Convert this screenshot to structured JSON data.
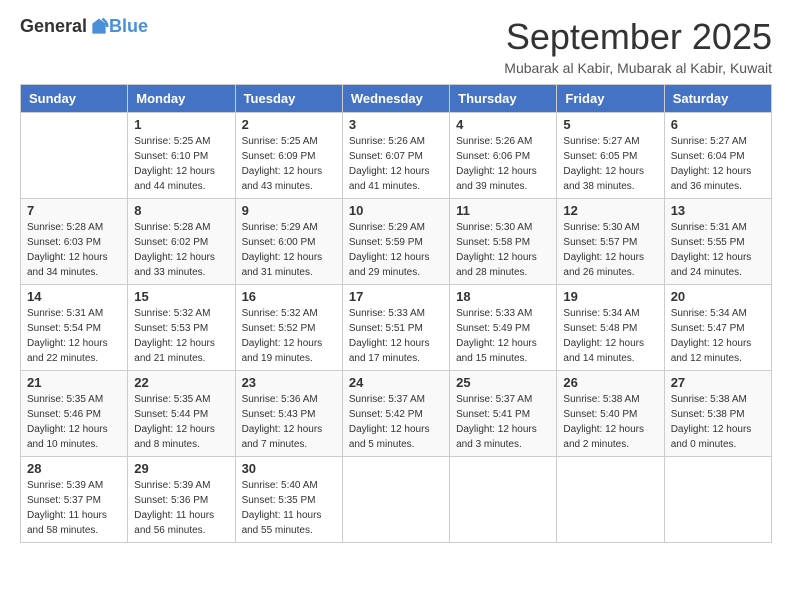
{
  "logo": {
    "general": "General",
    "blue": "Blue"
  },
  "header": {
    "month": "September 2025",
    "location": "Mubarak al Kabir, Mubarak al Kabir, Kuwait"
  },
  "weekdays": [
    "Sunday",
    "Monday",
    "Tuesday",
    "Wednesday",
    "Thursday",
    "Friday",
    "Saturday"
  ],
  "weeks": [
    [
      {
        "day": "",
        "sunrise": "",
        "sunset": "",
        "daylight": ""
      },
      {
        "day": "1",
        "sunrise": "Sunrise: 5:25 AM",
        "sunset": "Sunset: 6:10 PM",
        "daylight": "Daylight: 12 hours and 44 minutes."
      },
      {
        "day": "2",
        "sunrise": "Sunrise: 5:25 AM",
        "sunset": "Sunset: 6:09 PM",
        "daylight": "Daylight: 12 hours and 43 minutes."
      },
      {
        "day": "3",
        "sunrise": "Sunrise: 5:26 AM",
        "sunset": "Sunset: 6:07 PM",
        "daylight": "Daylight: 12 hours and 41 minutes."
      },
      {
        "day": "4",
        "sunrise": "Sunrise: 5:26 AM",
        "sunset": "Sunset: 6:06 PM",
        "daylight": "Daylight: 12 hours and 39 minutes."
      },
      {
        "day": "5",
        "sunrise": "Sunrise: 5:27 AM",
        "sunset": "Sunset: 6:05 PM",
        "daylight": "Daylight: 12 hours and 38 minutes."
      },
      {
        "day": "6",
        "sunrise": "Sunrise: 5:27 AM",
        "sunset": "Sunset: 6:04 PM",
        "daylight": "Daylight: 12 hours and 36 minutes."
      }
    ],
    [
      {
        "day": "7",
        "sunrise": "Sunrise: 5:28 AM",
        "sunset": "Sunset: 6:03 PM",
        "daylight": "Daylight: 12 hours and 34 minutes."
      },
      {
        "day": "8",
        "sunrise": "Sunrise: 5:28 AM",
        "sunset": "Sunset: 6:02 PM",
        "daylight": "Daylight: 12 hours and 33 minutes."
      },
      {
        "day": "9",
        "sunrise": "Sunrise: 5:29 AM",
        "sunset": "Sunset: 6:00 PM",
        "daylight": "Daylight: 12 hours and 31 minutes."
      },
      {
        "day": "10",
        "sunrise": "Sunrise: 5:29 AM",
        "sunset": "Sunset: 5:59 PM",
        "daylight": "Daylight: 12 hours and 29 minutes."
      },
      {
        "day": "11",
        "sunrise": "Sunrise: 5:30 AM",
        "sunset": "Sunset: 5:58 PM",
        "daylight": "Daylight: 12 hours and 28 minutes."
      },
      {
        "day": "12",
        "sunrise": "Sunrise: 5:30 AM",
        "sunset": "Sunset: 5:57 PM",
        "daylight": "Daylight: 12 hours and 26 minutes."
      },
      {
        "day": "13",
        "sunrise": "Sunrise: 5:31 AM",
        "sunset": "Sunset: 5:55 PM",
        "daylight": "Daylight: 12 hours and 24 minutes."
      }
    ],
    [
      {
        "day": "14",
        "sunrise": "Sunrise: 5:31 AM",
        "sunset": "Sunset: 5:54 PM",
        "daylight": "Daylight: 12 hours and 22 minutes."
      },
      {
        "day": "15",
        "sunrise": "Sunrise: 5:32 AM",
        "sunset": "Sunset: 5:53 PM",
        "daylight": "Daylight: 12 hours and 21 minutes."
      },
      {
        "day": "16",
        "sunrise": "Sunrise: 5:32 AM",
        "sunset": "Sunset: 5:52 PM",
        "daylight": "Daylight: 12 hours and 19 minutes."
      },
      {
        "day": "17",
        "sunrise": "Sunrise: 5:33 AM",
        "sunset": "Sunset: 5:51 PM",
        "daylight": "Daylight: 12 hours and 17 minutes."
      },
      {
        "day": "18",
        "sunrise": "Sunrise: 5:33 AM",
        "sunset": "Sunset: 5:49 PM",
        "daylight": "Daylight: 12 hours and 15 minutes."
      },
      {
        "day": "19",
        "sunrise": "Sunrise: 5:34 AM",
        "sunset": "Sunset: 5:48 PM",
        "daylight": "Daylight: 12 hours and 14 minutes."
      },
      {
        "day": "20",
        "sunrise": "Sunrise: 5:34 AM",
        "sunset": "Sunset: 5:47 PM",
        "daylight": "Daylight: 12 hours and 12 minutes."
      }
    ],
    [
      {
        "day": "21",
        "sunrise": "Sunrise: 5:35 AM",
        "sunset": "Sunset: 5:46 PM",
        "daylight": "Daylight: 12 hours and 10 minutes."
      },
      {
        "day": "22",
        "sunrise": "Sunrise: 5:35 AM",
        "sunset": "Sunset: 5:44 PM",
        "daylight": "Daylight: 12 hours and 8 minutes."
      },
      {
        "day": "23",
        "sunrise": "Sunrise: 5:36 AM",
        "sunset": "Sunset: 5:43 PM",
        "daylight": "Daylight: 12 hours and 7 minutes."
      },
      {
        "day": "24",
        "sunrise": "Sunrise: 5:37 AM",
        "sunset": "Sunset: 5:42 PM",
        "daylight": "Daylight: 12 hours and 5 minutes."
      },
      {
        "day": "25",
        "sunrise": "Sunrise: 5:37 AM",
        "sunset": "Sunset: 5:41 PM",
        "daylight": "Daylight: 12 hours and 3 minutes."
      },
      {
        "day": "26",
        "sunrise": "Sunrise: 5:38 AM",
        "sunset": "Sunset: 5:40 PM",
        "daylight": "Daylight: 12 hours and 2 minutes."
      },
      {
        "day": "27",
        "sunrise": "Sunrise: 5:38 AM",
        "sunset": "Sunset: 5:38 PM",
        "daylight": "Daylight: 12 hours and 0 minutes."
      }
    ],
    [
      {
        "day": "28",
        "sunrise": "Sunrise: 5:39 AM",
        "sunset": "Sunset: 5:37 PM",
        "daylight": "Daylight: 11 hours and 58 minutes."
      },
      {
        "day": "29",
        "sunrise": "Sunrise: 5:39 AM",
        "sunset": "Sunset: 5:36 PM",
        "daylight": "Daylight: 11 hours and 56 minutes."
      },
      {
        "day": "30",
        "sunrise": "Sunrise: 5:40 AM",
        "sunset": "Sunset: 5:35 PM",
        "daylight": "Daylight: 11 hours and 55 minutes."
      },
      {
        "day": "",
        "sunrise": "",
        "sunset": "",
        "daylight": ""
      },
      {
        "day": "",
        "sunrise": "",
        "sunset": "",
        "daylight": ""
      },
      {
        "day": "",
        "sunrise": "",
        "sunset": "",
        "daylight": ""
      },
      {
        "day": "",
        "sunrise": "",
        "sunset": "",
        "daylight": ""
      }
    ]
  ]
}
